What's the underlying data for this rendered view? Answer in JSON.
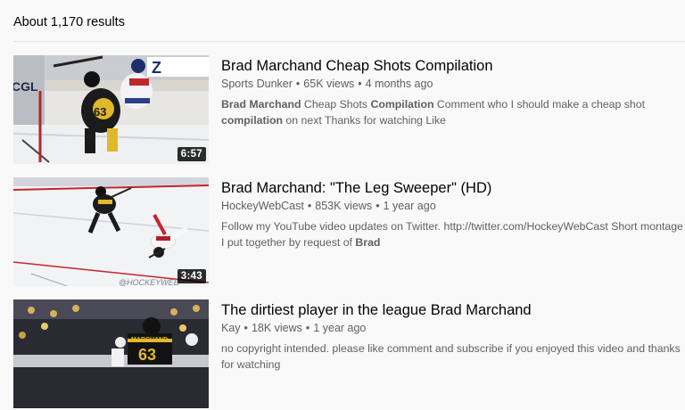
{
  "results": {
    "count_text": "About 1,170 results"
  },
  "videos": [
    {
      "title": "Brad Marchand Cheap Shots Compilation",
      "channel": "Sports Dunker",
      "views": "65K views",
      "age": "4 months ago",
      "duration": "6:57",
      "description": [
        {
          "t": "Brad Marchand",
          "b": true
        },
        {
          "t": " Cheap Shots ",
          "b": false
        },
        {
          "t": "Compilation",
          "b": true
        },
        {
          "t": " Comment who I should make a cheap shot ",
          "b": false
        },
        {
          "t": "compilation",
          "b": true
        },
        {
          "t": " on next Thanks for watching Like",
          "b": false
        }
      ],
      "thumb_text": "CGL"
    },
    {
      "title": "Brad Marchand: \"The Leg Sweeper\" (HD)",
      "channel": "HockeyWebCast",
      "views": "853K views",
      "age": "1 year ago",
      "duration": "3:43",
      "description": [
        {
          "t": "Follow my YouTube video updates on Twitter. http://twitter.com/HockeyWebCast Short montage I put together by request of ",
          "b": false
        },
        {
          "t": "Brad",
          "b": true
        }
      ],
      "thumb_text": "@HOCKEYWEB"
    },
    {
      "title": "The dirtiest player in the league Brad Marchand",
      "channel": "Kay",
      "views": "18K views",
      "age": "1 year ago",
      "duration": "",
      "description": [
        {
          "t": "no copyright intended. please like comment and subscribe if you enjoyed this video and thanks for watching",
          "b": false
        }
      ],
      "thumb_text": "MARCHAND 63"
    }
  ],
  "colors": {
    "background": "#f9f9f9",
    "meta_gray": "#606060",
    "title": "#030303"
  },
  "meta_separator": "•"
}
